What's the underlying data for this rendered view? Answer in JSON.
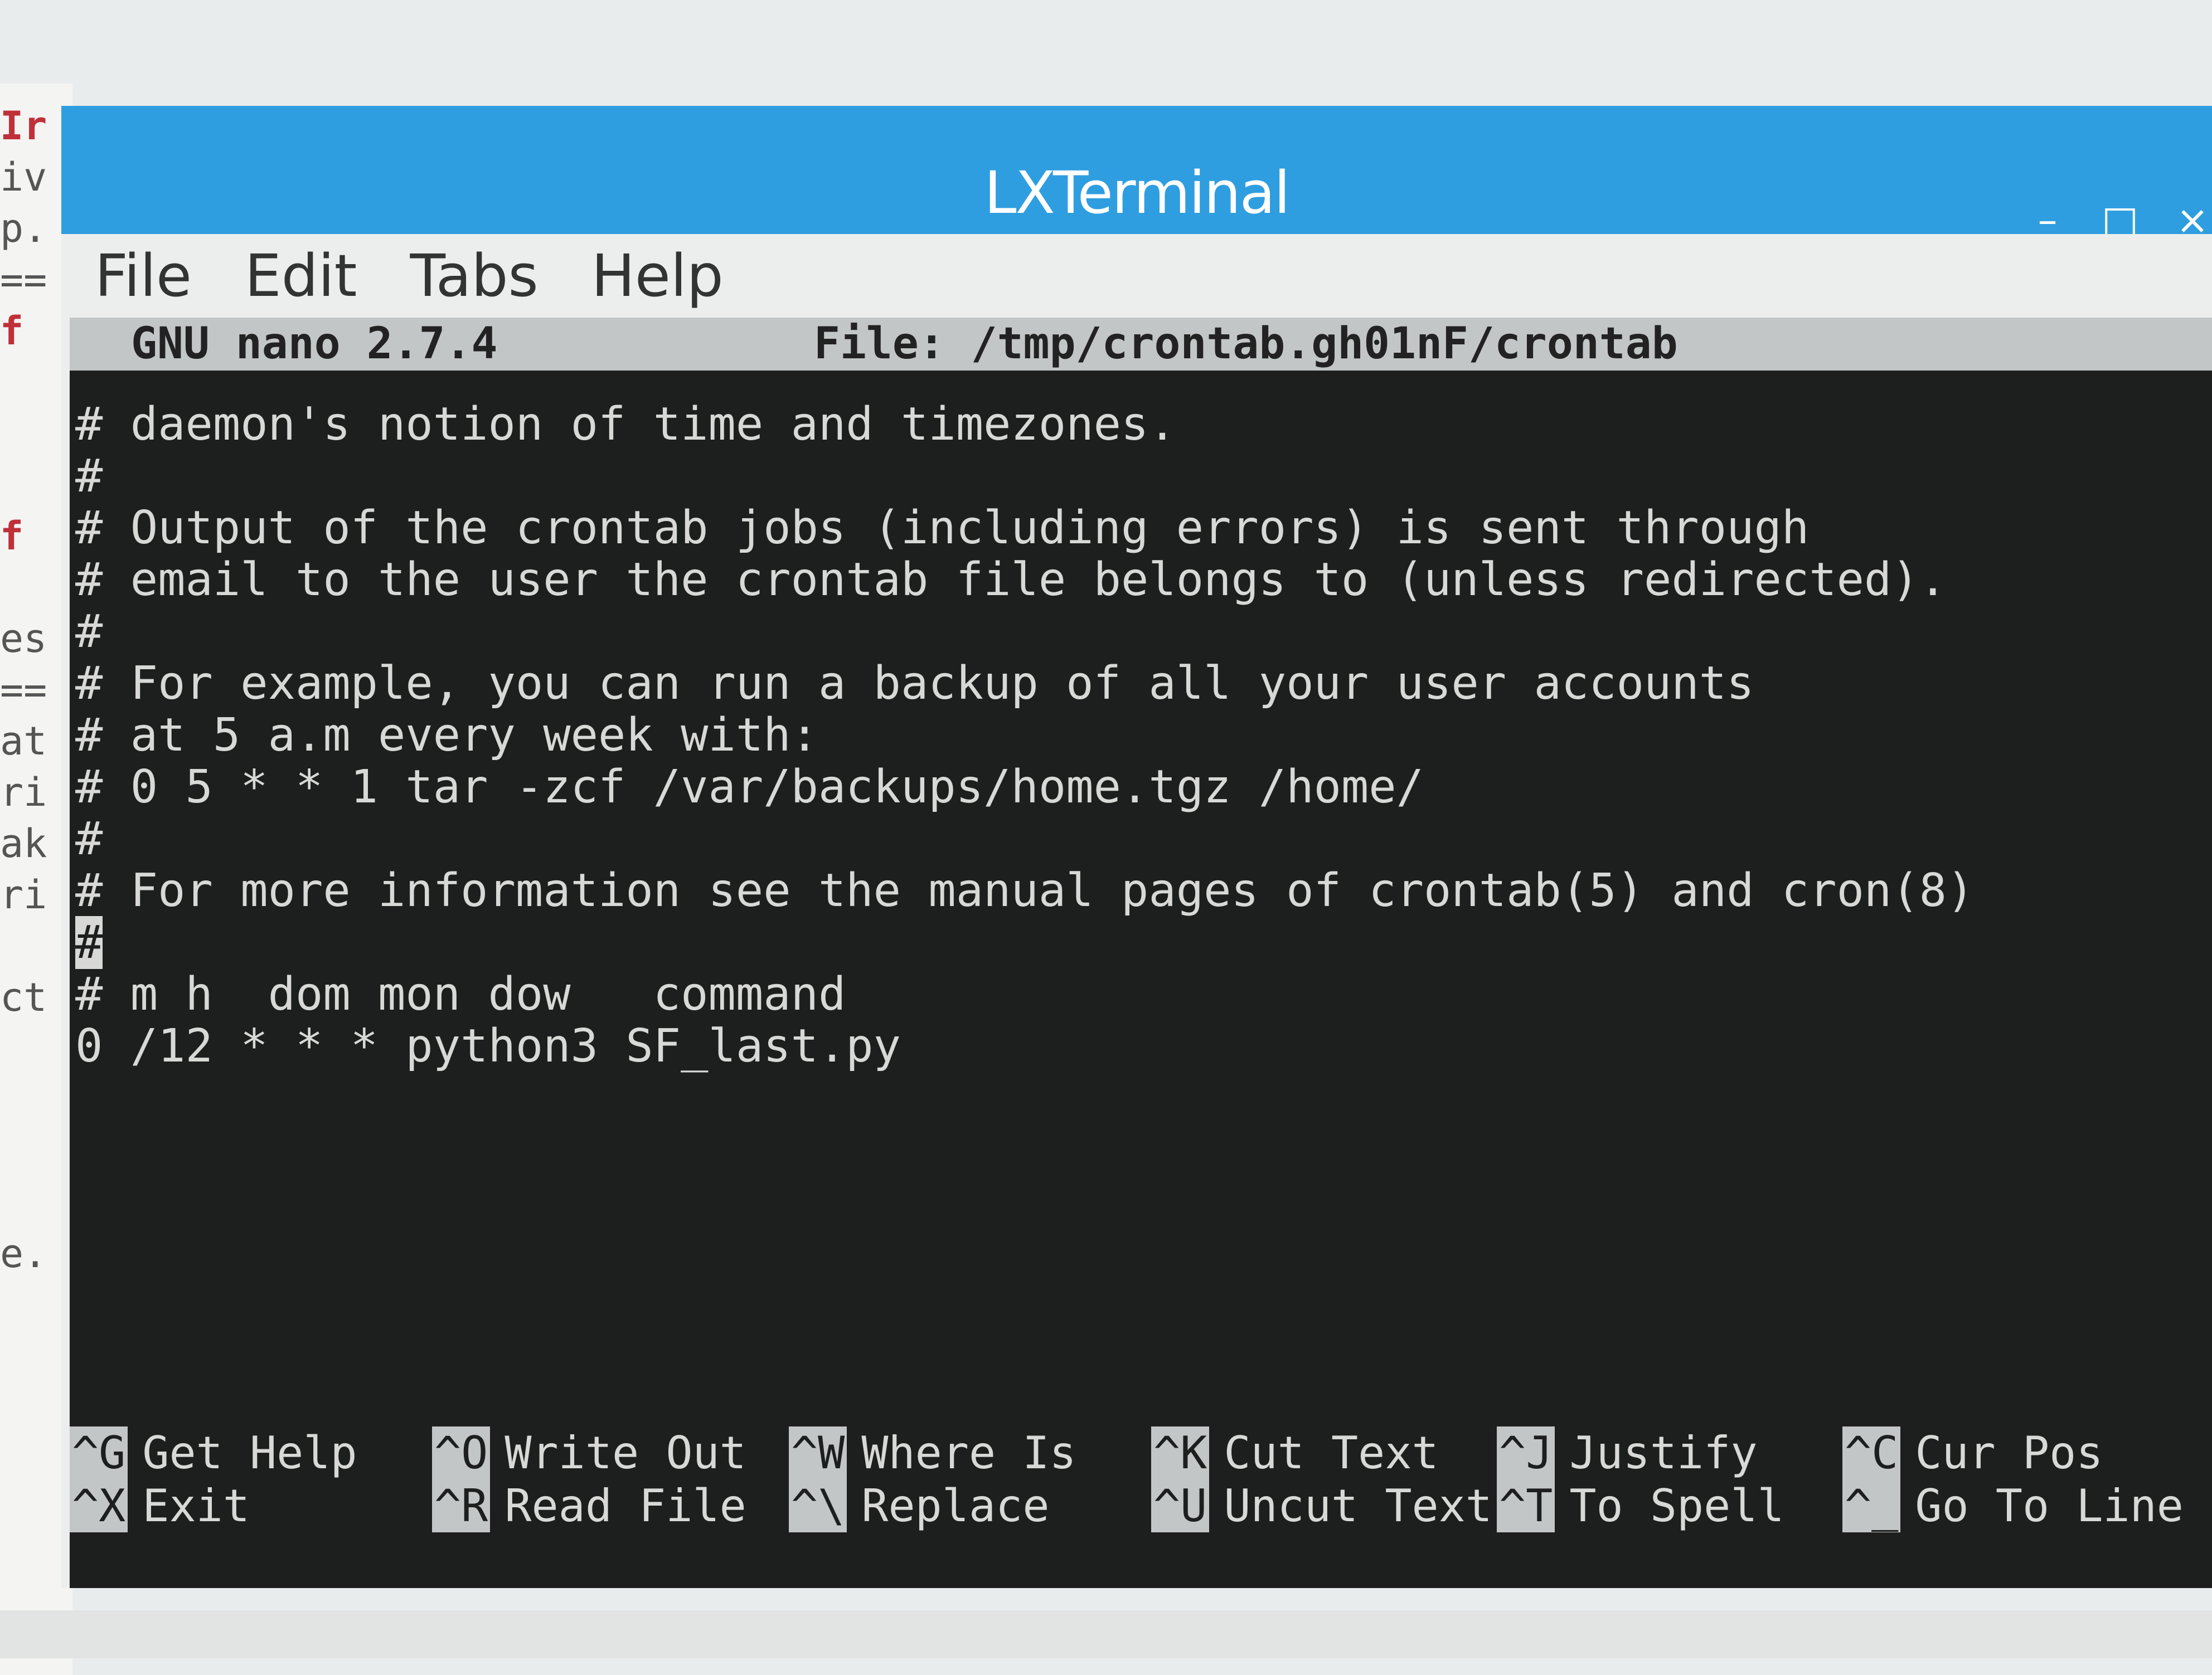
{
  "background_window": {
    "fragments": [
      "Ir",
      "iv",
      "p.",
      "==",
      "f",
      "",
      "",
      "",
      "f",
      "",
      "es",
      "==",
      "at",
      "ri",
      "ak",
      "ri",
      "",
      "ct",
      "",
      "",
      "",
      "",
      "e."
    ]
  },
  "window": {
    "title": "LXTerminal",
    "controls": {
      "minimize": "–",
      "maximize": "□",
      "close": "×"
    },
    "menu": [
      "File",
      "Edit",
      "Tabs",
      "Help"
    ]
  },
  "nano": {
    "version": "GNU nano 2.7.4",
    "file": "File: /tmp/crontab.gh01nF/crontab",
    "lines": [
      "# daemon's notion of time and timezones.",
      "#",
      "# Output of the crontab jobs (including errors) is sent through",
      "# email to the user the crontab file belongs to (unless redirected).",
      "#",
      "# For example, you can run a backup of all your user accounts",
      "# at 5 a.m every week with:",
      "# 0 5 * * 1 tar -zcf /var/backups/home.tgz /home/",
      "#",
      "# For more information see the manual pages of crontab(5) and cron(8)",
      "#",
      "# m h  dom mon dow   command",
      "0 /12 * * * python3 SF_last.py"
    ],
    "cursor_line_index": 10,
    "shortcuts": [
      {
        "key": "^G",
        "label": "Get Help"
      },
      {
        "key": "^X",
        "label": "Exit"
      },
      {
        "key": "^O",
        "label": "Write Out"
      },
      {
        "key": "^R",
        "label": "Read File"
      },
      {
        "key": "^W",
        "label": "Where Is"
      },
      {
        "key": "^\\",
        "label": "Replace"
      },
      {
        "key": "^K",
        "label": "Cut Text"
      },
      {
        "key": "^U",
        "label": "Uncut Text"
      },
      {
        "key": "^J",
        "label": "Justify"
      },
      {
        "key": "^T",
        "label": "To Spell"
      },
      {
        "key": "^C",
        "label": "Cur Pos"
      },
      {
        "key": "^_",
        "label": "Go To Line"
      }
    ]
  },
  "colors": {
    "titlebar": "#2f9ee0",
    "terminal_bg": "#1d1e1e",
    "terminal_fg": "#d8d8d6",
    "header_bg": "#c3c6c6"
  }
}
